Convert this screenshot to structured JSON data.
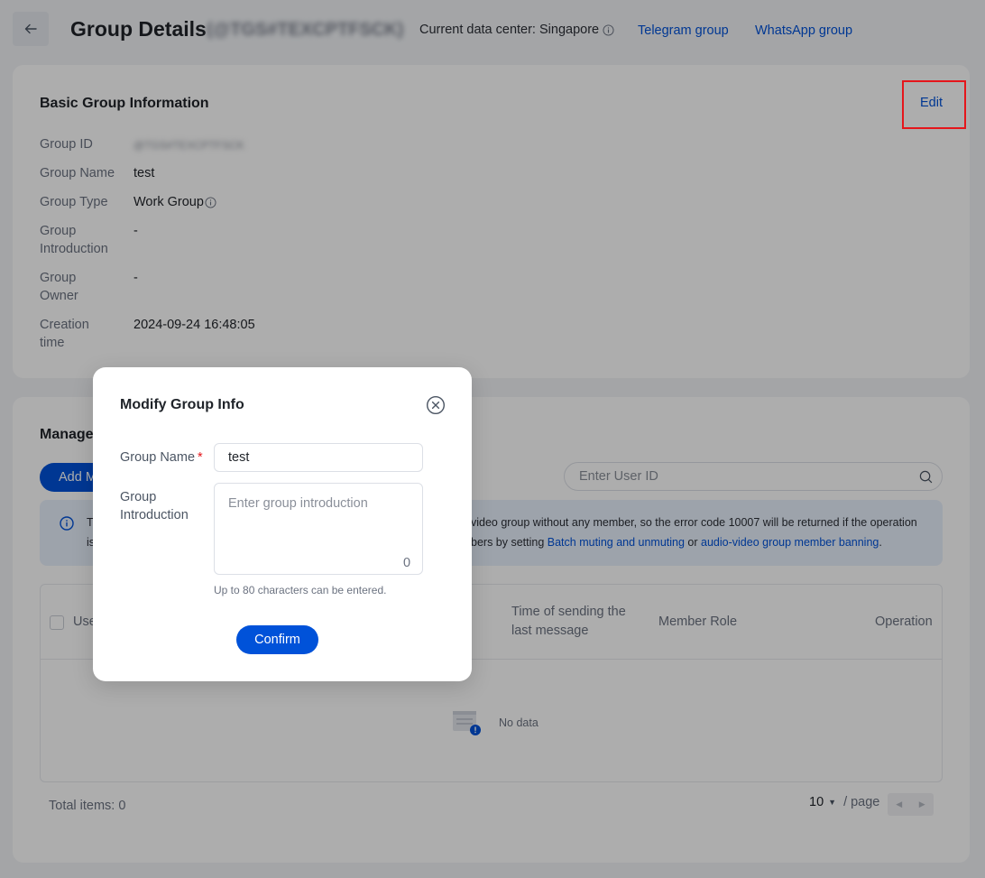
{
  "header": {
    "title": "Group Details",
    "group_id": "(@TGS#TEXCPTFSCK)",
    "data_center": "Current data center: Singapore",
    "telegram_link": "Telegram group",
    "whatsapp_link": "WhatsApp group"
  },
  "basic_info": {
    "title": "Basic Group Information",
    "edit_label": "Edit",
    "rows": [
      {
        "label": "Group ID",
        "value": "@TGS#TEXCPTFSCK"
      },
      {
        "label": "Group Name",
        "value": "test"
      },
      {
        "label": "Group Type",
        "value": "Work Group"
      },
      {
        "label": "Group Introduction",
        "value": "-"
      },
      {
        "label": "Group Owner",
        "value": "-"
      },
      {
        "label": "Creation time",
        "value": "2024-09-24 16:48:05"
      }
    ]
  },
  "manage": {
    "title": "Manage",
    "add_button": "Add M",
    "search_placeholder": "Enter User ID",
    "notice_start_1": "T",
    "notice_end_1": "video group without any member, so the error code 10007 will be returned if the operation",
    "notice_start_2": "is",
    "notice_end_2_pre": "bers by setting ",
    "notice_link_1": "Batch muting and unmuting",
    "notice_mid": " or ",
    "notice_link_2": "audio-video group member banning",
    "notice_end_2_post": ".",
    "columns": {
      "user": "Use",
      "last_message": "Time of sending the last message",
      "role": "Member Role",
      "operation": "Operation"
    },
    "empty_text": "No data",
    "total_label": "Total items:",
    "total_value": "0",
    "page_size": "10",
    "page_unit": "/ page"
  },
  "modal": {
    "title": "Modify Group Info",
    "name_label": "Group Name",
    "required_mark": "*",
    "name_value": "test",
    "intro_label": "Group Introduction",
    "intro_placeholder": "Enter group introduction",
    "char_count": "0",
    "hint": "Up to 80 characters can be entered.",
    "confirm_label": "Confirm"
  }
}
